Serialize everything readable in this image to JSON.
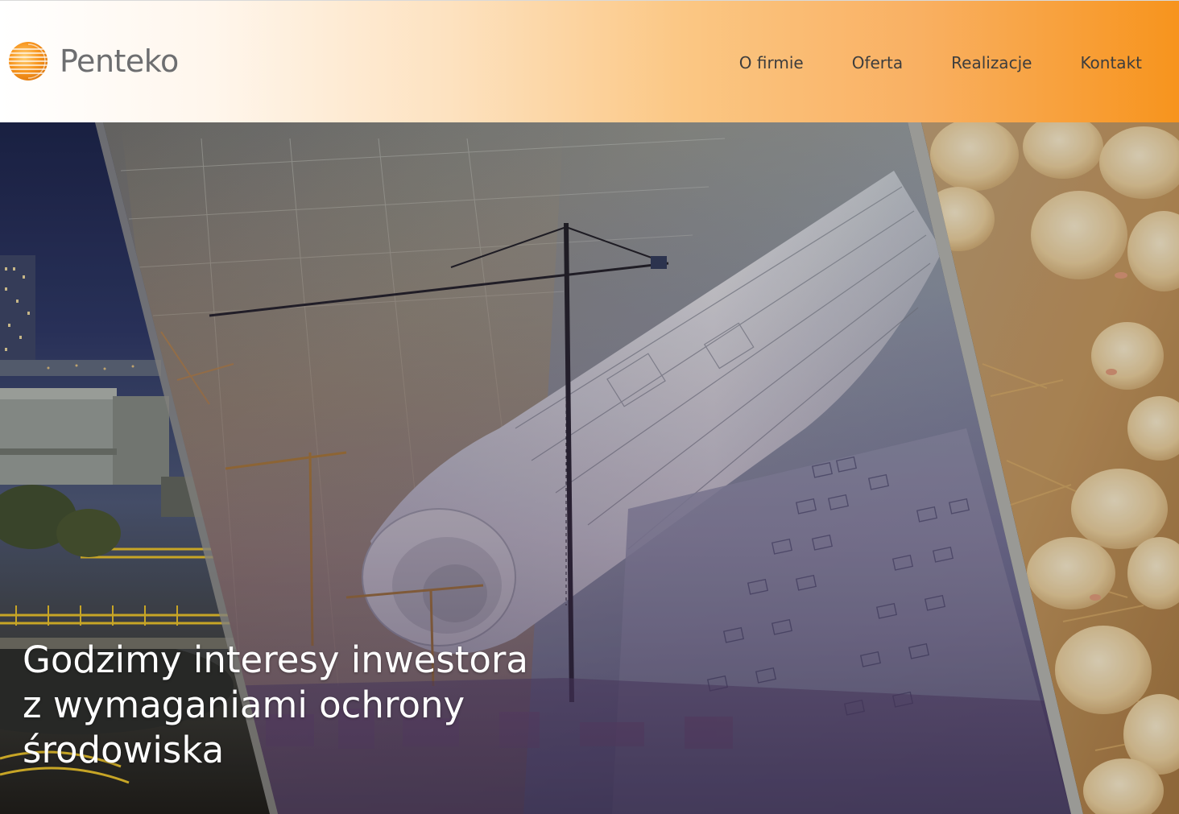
{
  "brand": {
    "name": "Penteko",
    "accent": "#f7941d",
    "text_color": "#6d6e70"
  },
  "nav": {
    "items": [
      {
        "label": "O firmie"
      },
      {
        "label": "Oferta"
      },
      {
        "label": "Realizacje"
      },
      {
        "label": "Kontakt"
      }
    ]
  },
  "hero": {
    "title_lines": [
      "Godzimy interesy inwestora",
      "z wymaganiami ochrony",
      "środowiska"
    ],
    "panels": [
      "industrial-plant-photo",
      "construction-blueprints-photo",
      "chicks-farm-photo"
    ]
  }
}
